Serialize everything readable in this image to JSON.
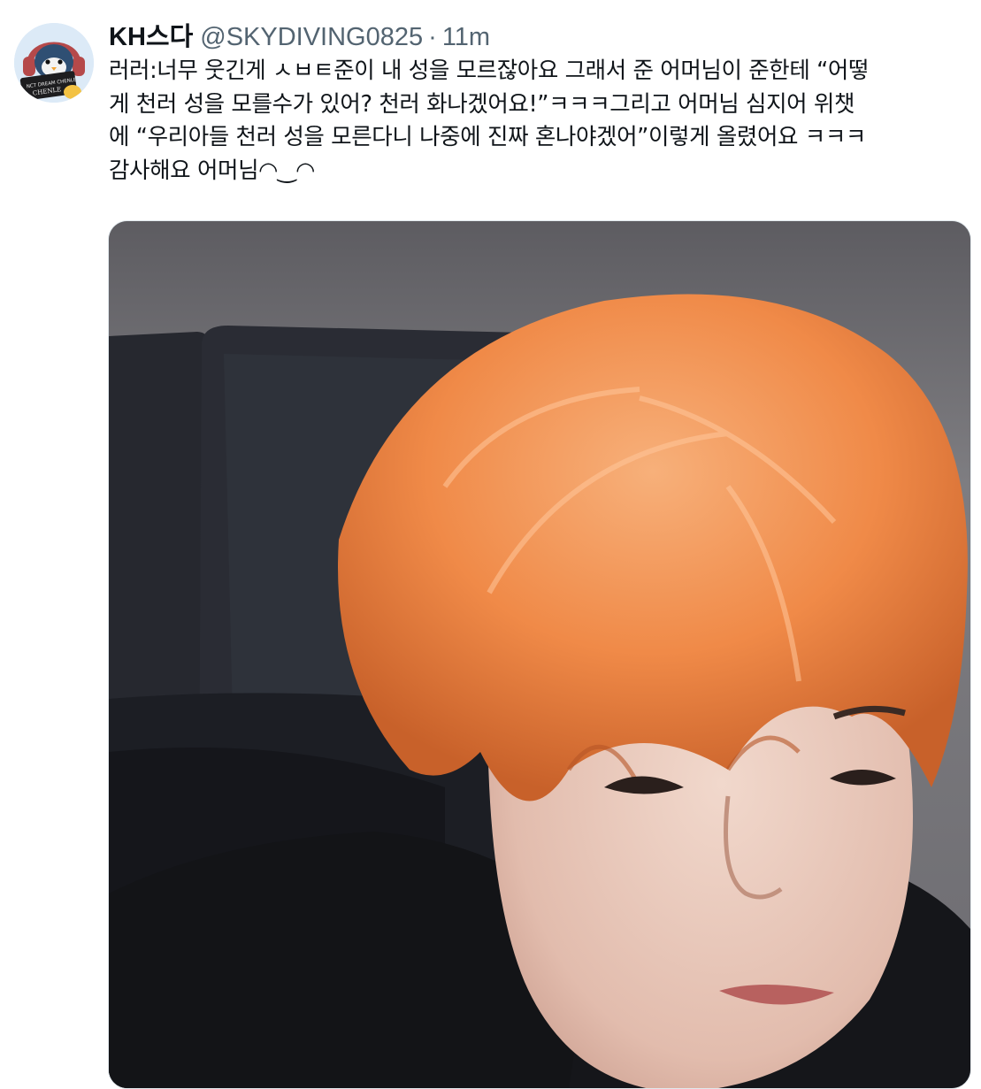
{
  "tweet": {
    "author": {
      "display_name": "KH스다",
      "handle": "@SKYDIVING0825",
      "avatar_icon": "penguin-avatar-icon",
      "avatar_caption_top": "NCT DREAM CHENLE",
      "avatar_caption_bottom": "CHENLE"
    },
    "separator": "·",
    "timestamp": "11m",
    "text_lines": [
      "러러:너무 웃긴게 ㅅㅂㅌ준이 내 성을 모르잖아요 그래서 준 어머님이 준한테 “어떻",
      "게 천러 성을 모를수가 있어? 천러 화나겠어요!”ㅋㅋㅋ그리고 어머님 심지어 위챗",
      "에 “우리아들 천러 성을 모른다니 나중에 진짜 혼나야겠어”이렇게 올렸어요 ㅋㅋㅋ",
      "감사해요 어머님◠‿◠"
    ],
    "media": {
      "type": "photo",
      "subject": "orange-haired person in front of a dark leather couch"
    }
  },
  "colors": {
    "text_primary": "#0f1419",
    "text_secondary": "#536471",
    "hair": "#f08a48",
    "couch": "#25272e",
    "wall": "#7b7a7e"
  }
}
